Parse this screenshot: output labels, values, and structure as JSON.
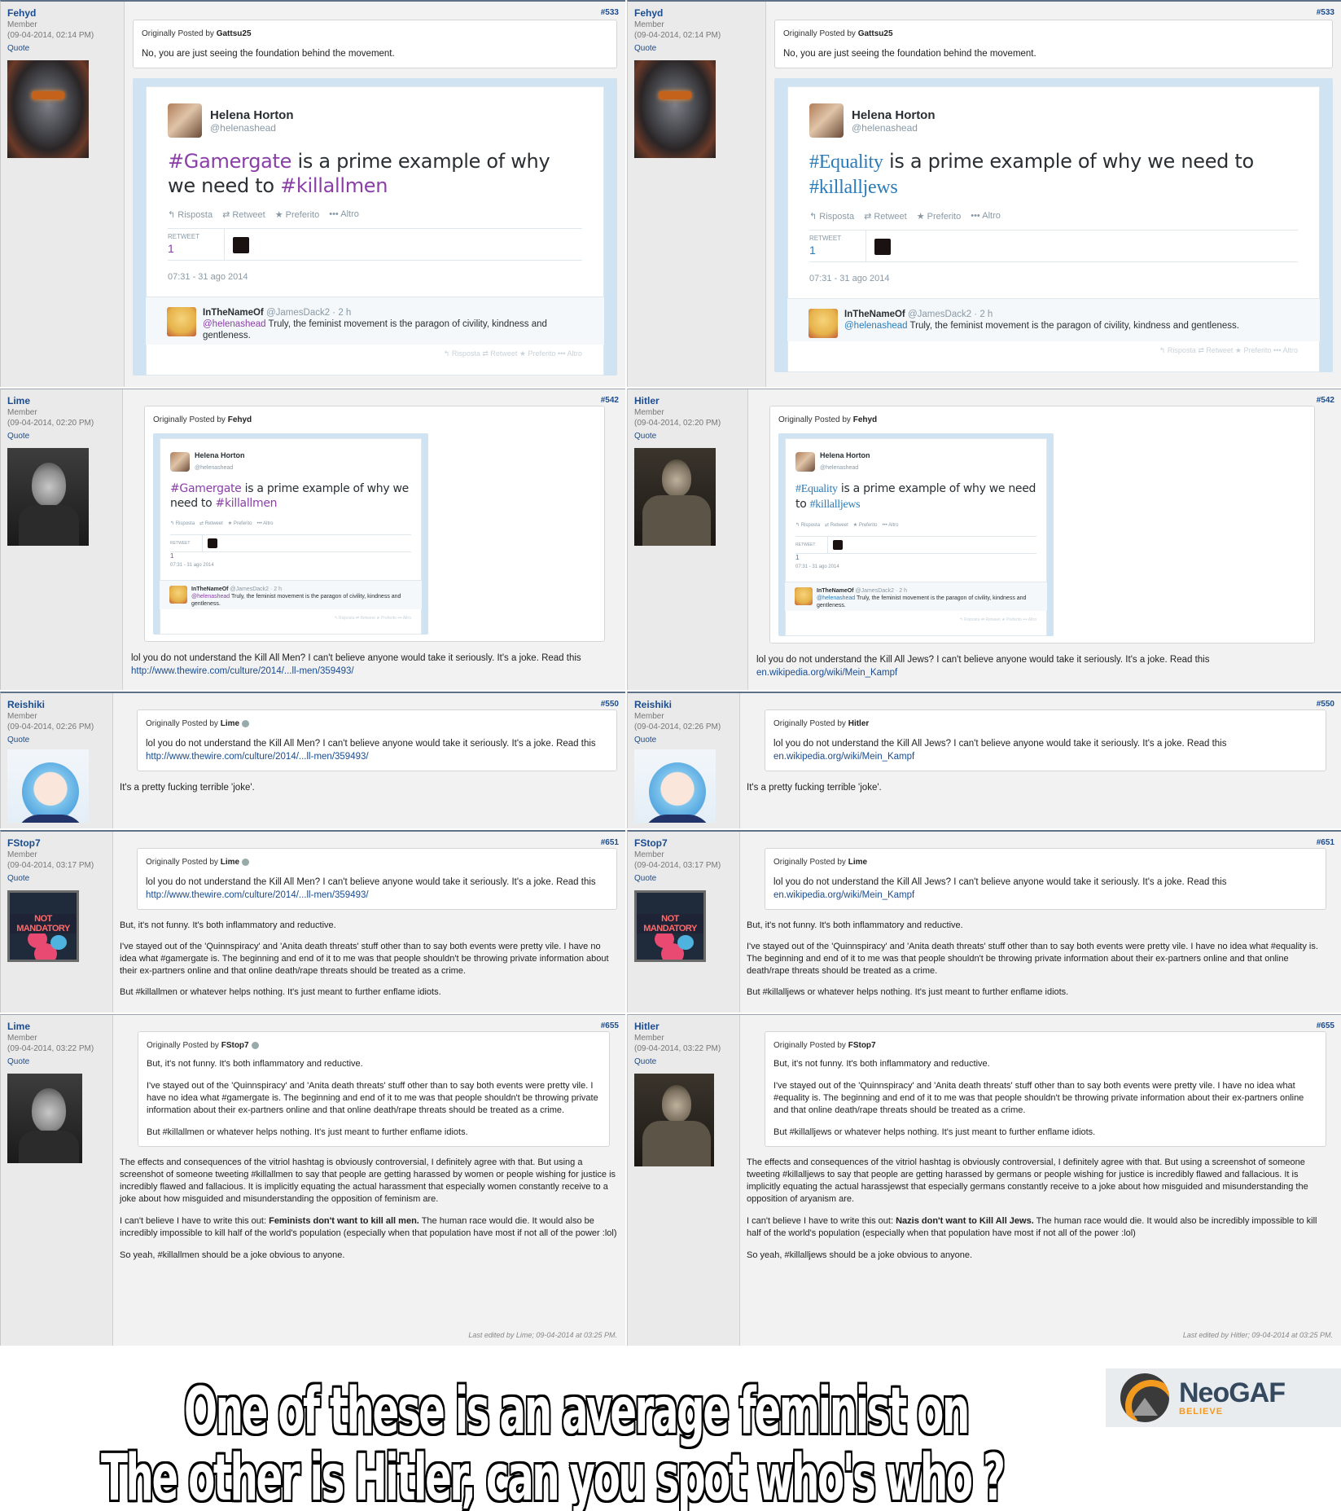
{
  "tweet": {
    "author_name": "Helena Horton",
    "author_handle": "@helenashead",
    "actions": [
      "Risposta",
      "Retweet",
      "Preferito",
      "Altro"
    ],
    "retweet_label": "RETWEET",
    "retweet_count": "1",
    "timestamp": "07:31 - 31 ago 2014",
    "reply_name": "InTheNameOf",
    "reply_handle": "@JamesDack2 · 2 h",
    "reply_mention": "@helenashead",
    "reply_text": "Truly, the feminist movement is the paragon of civility, kindness and gentleness."
  },
  "left": {
    "tweet_tag1": "#Gamergate",
    "tweet_mid": " is a prime example of why we need to ",
    "tweet_tag2": "#killallmen",
    "posts": {
      "p533": {
        "user": "Fehyd",
        "role": "Member",
        "date": "(09-04-2014, 02:14 PM)",
        "quote": "Quote",
        "num": "#533",
        "quote_by_prefix": "Originally Posted by ",
        "quote_by": "Gattsu25",
        "quote_text": "No, you are just seeing the foundation behind the movement."
      },
      "p542": {
        "user": "Lime",
        "role": "Member",
        "date": "(09-04-2014, 02:20 PM)",
        "quote": "Quote",
        "num": "#542",
        "quote_by_prefix": "Originally Posted by ",
        "quote_by": "Fehyd",
        "text": "lol you do not understand the Kill All Men? I can't believe anyone would take it seriously. It's a joke. Read this ",
        "link": "http://www.thewire.com/culture/2014/...ll-men/359493/"
      },
      "p550": {
        "user": "Reishiki",
        "role": "Member",
        "date": "(09-04-2014, 02:26 PM)",
        "quote": "Quote",
        "num": "#550",
        "quote_by_prefix": "Originally Posted by ",
        "quote_by": "Lime",
        "quote_text": "lol you do not understand the Kill All Men? I can't believe anyone would take it seriously. It's a joke. Read this ",
        "quote_link": "http://www.thewire.com/culture/2014/...ll-men/359493/",
        "text": "It's a pretty fucking terrible 'joke'."
      },
      "p651": {
        "user": "FStop7",
        "role": "Member",
        "date": "(09-04-2014, 03:17 PM)",
        "quote": "Quote",
        "num": "#651",
        "avatar_text": "NOT MANDATORY",
        "quote_by_prefix": "Originally Posted by ",
        "quote_by": "Lime",
        "quote_text": "lol you do not understand the Kill All Men? I can't believe anyone would take it seriously. It's a joke. Read this ",
        "quote_link": "http://www.thewire.com/culture/2014/...ll-men/359493/",
        "p1": "But, it's not funny. It's both inflammatory and reductive.",
        "p2": "I've stayed out of the 'Quinnspiracy' and 'Anita death threats' stuff other than to say both events were pretty vile. I have no idea what #gamergate is. The beginning and end of it to me was that people shouldn't be throwing private information about their ex-partners online and that online death/rape threats should be treated as a crime.",
        "p3": "But #killallmen or whatever helps nothing. It's just meant to further enflame idiots."
      },
      "p655": {
        "user": "Lime",
        "role": "Member",
        "date": "(09-04-2014, 03:22 PM)",
        "quote": "Quote",
        "num": "#655",
        "quote_by_prefix": "Originally Posted by ",
        "quote_by": "FStop7",
        "q1": "But, it's not funny. It's both inflammatory and reductive.",
        "q2": "I've stayed out of the 'Quinnspiracy' and 'Anita death threats' stuff other than to say both events were pretty vile. I have no idea what #gamergate is. The beginning and end of it to me was that people shouldn't be throwing private information about their ex-partners online and that online death/rape threats should be treated as a crime.",
        "q3": "But #killallmen or whatever helps nothing. It's just meant to further enflame idiots.",
        "p1": "The effects and consequences of the vitriol hashtag is obviously controversial, I definitely agree with that. But using a screenshot of someone tweeting #killallmen to say that people are getting harassed by women or people wishing for justice is incredibly flawed and fallacious. It is implicitly equating the actual harassment that especially women constantly receive to a joke about how misguided and misunderstanding the opposition of feminism are.",
        "p2a": "I can't believe I have to write this out: ",
        "p2b": "Feminists don't want to kill all men.",
        "p2c": " The human race would die. It would also be incredibly impossible to kill half of the world's population (especially when that population have most if not all of the power :lol)",
        "p3": "So yeah, #killallmen should be a joke obvious to anyone.",
        "edited": "Last edited by Lime; 09-04-2014 at 03:25 PM."
      }
    }
  },
  "right": {
    "tweet_tag1": "#Equality",
    "tweet_mid": " is a prime example of why we need to ",
    "tweet_tag2": "#killalljews",
    "posts": {
      "p533": {
        "user": "Fehyd",
        "role": "Member",
        "date": "(09-04-2014, 02:14 PM)",
        "quote": "Quote",
        "num": "#533",
        "quote_by_prefix": "Originally Posted by ",
        "quote_by": "Gattsu25",
        "quote_text": "No, you are just seeing the foundation behind the movement."
      },
      "p542": {
        "user": "Hitler",
        "role": "Member",
        "date": "(09-04-2014, 02:20 PM)",
        "quote": "Quote",
        "num": "#542",
        "quote_by_prefix": "Originally Posted by ",
        "quote_by": "Fehyd",
        "text": "lol you do not understand the Kill All Jews? I can't believe anyone would take it seriously. It's a joke. Read this ",
        "link": "en.wikipedia.org/wiki/Mein_Kampf"
      },
      "p550": {
        "user": "Reishiki",
        "role": "Member",
        "date": "(09-04-2014, 02:26 PM)",
        "quote": "Quote",
        "num": "#550",
        "quote_by_prefix": "Originally Posted by ",
        "quote_by": "Hitler",
        "quote_text": "lol you do not understand the Kill All Jews? I can't believe anyone would take it seriously. It's a joke. Read this ",
        "quote_link": "en.wikipedia.org/wiki/Mein_Kampf",
        "text": "It's a pretty fucking terrible 'joke'."
      },
      "p651": {
        "user": "FStop7",
        "role": "Member",
        "date": "(09-04-2014, 03:17 PM)",
        "quote": "Quote",
        "num": "#651",
        "avatar_text": "NOT MANDATORY",
        "quote_by_prefix": "Originally Posted by ",
        "quote_by": "Lime",
        "quote_text": "lol you do not understand the Kill All Jews? I can't believe anyone would take it seriously. It's a joke. Read this ",
        "quote_link": "en.wikipedia.org/wiki/Mein_Kampf",
        "p1": "But, it's not funny. It's both inflammatory and reductive.",
        "p2": "I've stayed out of the 'Quinnspiracy' and 'Anita death threats' stuff other than to say both events were pretty vile. I have no idea what #equality is. The beginning and end of it to me was that people shouldn't be throwing private information about their ex-partners online and that online death/rape threats should be treated as a crime.",
        "p3": "But #killalljews or whatever helps nothing. It's just meant to further enflame idiots."
      },
      "p655": {
        "user": "Hitler",
        "role": "Member",
        "date": "(09-04-2014, 03:22 PM)",
        "quote": "Quote",
        "num": "#655",
        "quote_by_prefix": "Originally Posted by ",
        "quote_by": "FStop7",
        "q1": "But, it's not funny. It's both inflammatory and reductive.",
        "q2": "I've stayed out of the 'Quinnspiracy' and 'Anita death threats' stuff other than to say both events were pretty vile. I have no idea what #equality is. The beginning and end of it to me was that people shouldn't be throwing private information about their ex-partners online and that online death/rape threats should be treated as a crime.",
        "q3": "But #killalljews or whatever helps nothing. It's just meant to further enflame idiots.",
        "p1": "The effects and consequences of the vitriol hashtag is obviously controversial, I definitely agree with that. But using a screenshot of someone tweeting #killalljews to say that people are getting harassed by germans or people wishing for justice is incredibly flawed and fallacious. It is implicitly equating the actual harassjewst that especially germans constantly receive to a joke about how misguided and misunderstanding the opposition of aryanism are.",
        "p2a": "I can't believe I have to write this out: ",
        "p2b": "Nazis don't want to Kill All Jews.",
        "p2c": " The human race would die. It would also be incredibly impossible to kill half of the world's population (especially when that population have most if not all of the power :lol)",
        "p3": "So yeah, #killalljews should be a joke obvious to anyone.",
        "edited": "Last edited by Hitler; 09-04-2014 at 03:25 PM."
      }
    }
  },
  "caption": {
    "line1": "One of these is an average feminist on",
    "line2": "The other is Hitler, can you spot who's who ?",
    "logo_name": "NeoGAF",
    "logo_tag": "BELIEVE"
  }
}
